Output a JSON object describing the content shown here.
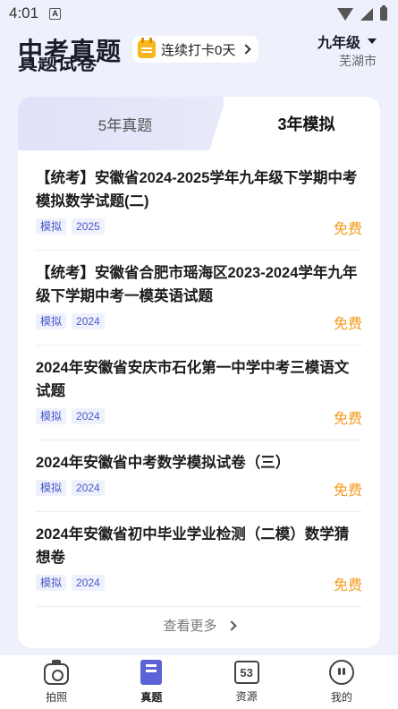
{
  "status": {
    "time": "4:01",
    "notification_letter": "A"
  },
  "header": {
    "title": "中考真题",
    "checkin_label": "连续打卡0天",
    "grade": "九年级",
    "city": "芜湖市"
  },
  "section": {
    "title": "真题试卷"
  },
  "tabs": [
    {
      "label": "5年真题",
      "active": false
    },
    {
      "label": "3年模拟",
      "active": true
    }
  ],
  "items": [
    {
      "title": "【统考】安徽省2024-2025学年九年级下学期中考模拟数学试题(二)",
      "tags": [
        "模拟",
        "2025"
      ],
      "price": "免费"
    },
    {
      "title": "【统考】安徽省合肥市瑶海区2023-2024学年九年级下学期中考一模英语试题",
      "tags": [
        "模拟",
        "2024"
      ],
      "price": "免费"
    },
    {
      "title": "2024年安徽省安庆市石化第一中学中考三模语文试题",
      "tags": [
        "模拟",
        "2024"
      ],
      "price": "免费"
    },
    {
      "title": "2024年安徽省中考数学模拟试卷（三）",
      "tags": [
        "模拟",
        "2024"
      ],
      "price": "免费"
    },
    {
      "title": "2024年安徽省初中毕业学业检测（二模）数学猜想卷",
      "tags": [
        "模拟",
        "2024"
      ],
      "price": "免费"
    }
  ],
  "more_label": "查看更多",
  "nav": [
    {
      "label": "拍照",
      "icon": "camera-icon"
    },
    {
      "label": "真题",
      "icon": "book-icon",
      "active": true
    },
    {
      "label": "资源",
      "icon": "resource-53-icon",
      "icon_text": "53"
    },
    {
      "label": "我的",
      "icon": "profile-icon"
    }
  ],
  "colors": {
    "accent": "#5b63d6",
    "free": "#f59a1b",
    "tag_text": "#4a5ac9",
    "tag_bg": "#eef0fb"
  }
}
